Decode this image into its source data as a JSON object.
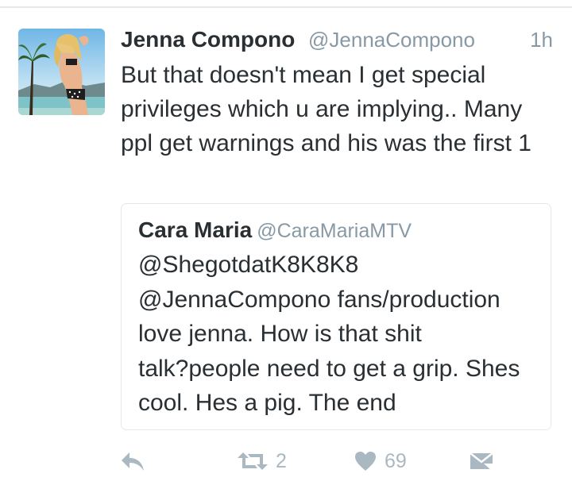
{
  "tweet": {
    "author_name": "Jenna Compono",
    "author_handle": "@JennaCompono",
    "timestamp": "1h",
    "text": "But that doesn't mean I get special privileges which u are implying.. Many ppl get warnings and his was the first 1",
    "avatar": "beach-photo-avatar"
  },
  "quoted_tweet": {
    "author_name": "Cara Maria",
    "author_handle": "@CaraMariaMTV",
    "text_lines": [
      "@ShegotdatK8K8K8",
      "@JennaCompono  fans/production",
      "love jenna. How is that shit",
      "talk?people need to get a grip. Shes",
      "cool. Hes a pig. The end"
    ]
  },
  "actions": {
    "reply_icon": "reply-icon",
    "retweet_icon": "retweet-icon",
    "retweet_count": "2",
    "like_icon": "heart-icon",
    "like_count": "69",
    "dm_icon": "direct-message-icon"
  },
  "colors": {
    "text_primary": "#292f33",
    "text_secondary": "#8899a6",
    "action_icon": "#aab8c2",
    "border": "#e1e8ed"
  }
}
